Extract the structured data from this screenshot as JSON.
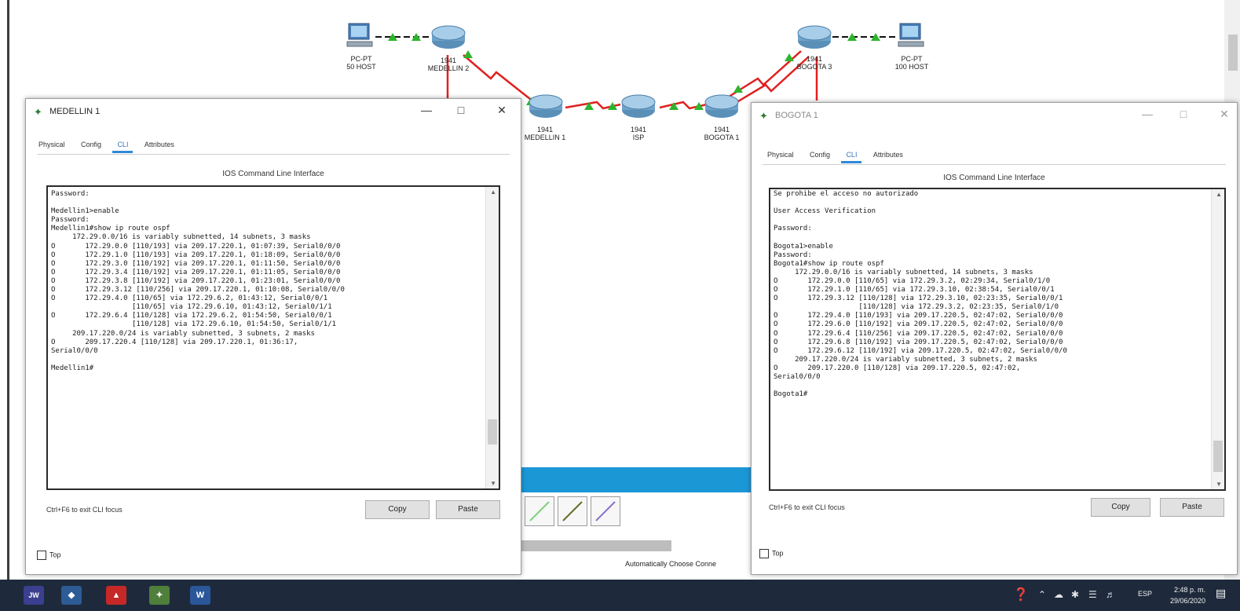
{
  "topology": {
    "devices": [
      {
        "id": "pc-medellin",
        "label_line1": "PC-PT",
        "label_line2": "50 HOST"
      },
      {
        "id": "router-medellin2",
        "label_line1": "1941",
        "label_line2": "MEDELLIN 2"
      },
      {
        "id": "router-medellin1",
        "label_line1": "1941",
        "label_line2": "MEDELLIN 1"
      },
      {
        "id": "router-isp",
        "label_line1": "1941",
        "label_line2": "ISP"
      },
      {
        "id": "router-bogota1",
        "label_line1": "1941",
        "label_line2": "BOGOTA 1"
      },
      {
        "id": "router-bogota3",
        "label_line1": "1941",
        "label_line2": "BOGOTA 3"
      },
      {
        "id": "pc-bogota",
        "label_line1": "PC-PT",
        "label_line2": "100 HOST"
      }
    ],
    "auto_cable_label": "Automatically Choose Conne"
  },
  "windows": {
    "medellin": {
      "title": "MEDELLIN 1",
      "tabs": [
        "Physical",
        "Config",
        "CLI",
        "Attributes"
      ],
      "active_tab": "CLI",
      "ios_title": "IOS Command Line Interface",
      "lines": [
        "Password:",
        "",
        "Medellin1>enable",
        "Password:",
        "Medellin1#show ip route ospf",
        "     172.29.0.0/16 is variably subnetted, 14 subnets, 3 masks",
        "O       172.29.0.0 [110/193] via 209.17.220.1, 01:07:39, Serial0/0/0",
        "O       172.29.1.0 [110/193] via 209.17.220.1, 01:18:09, Serial0/0/0",
        "O       172.29.3.0 [110/192] via 209.17.220.1, 01:11:50, Serial0/0/0",
        "O       172.29.3.4 [110/192] via 209.17.220.1, 01:11:05, Serial0/0/0",
        "O       172.29.3.8 [110/192] via 209.17.220.1, 01:23:01, Serial0/0/0",
        "O       172.29.3.12 [110/256] via 209.17.220.1, 01:10:08, Serial0/0/0",
        "O       172.29.4.0 [110/65] via 172.29.6.2, 01:43:12, Serial0/0/1",
        "                   [110/65] via 172.29.6.10, 01:43:12, Serial0/1/1",
        "O       172.29.6.4 [110/128] via 172.29.6.2, 01:54:50, Serial0/0/1",
        "                   [110/128] via 172.29.6.10, 01:54:50, Serial0/1/1",
        "     209.17.220.0/24 is variably subnetted, 3 subnets, 2 masks",
        "O       209.17.220.4 [110/128] via 209.17.220.1, 01:36:17,",
        "Serial0/0/0",
        "",
        "Medellin1#"
      ],
      "hint": "Ctrl+F6 to exit CLI focus",
      "copy_label": "Copy",
      "paste_label": "Paste",
      "top_label": "Top"
    },
    "bogota": {
      "title": "BOGOTA 1",
      "tabs": [
        "Physical",
        "Config",
        "CLI",
        "Attributes"
      ],
      "active_tab": "CLI",
      "ios_title": "IOS Command Line Interface",
      "lines": [
        "Se prohibe el acceso no autorizado",
        "",
        "User Access Verification",
        "",
        "Password:",
        "",
        "Bogota1>enable",
        "Password:",
        "Bogota1#show ip route ospf",
        "     172.29.0.0/16 is variably subnetted, 14 subnets, 3 masks",
        "O       172.29.0.0 [110/65] via 172.29.3.2, 02:29:34, Serial0/1/0",
        "O       172.29.1.0 [110/65] via 172.29.3.10, 02:38:54, Serial0/0/1",
        "O       172.29.3.12 [110/128] via 172.29.3.10, 02:23:35, Serial0/0/1",
        "                    [110/128] via 172.29.3.2, 02:23:35, Serial0/1/0",
        "O       172.29.4.0 [110/193] via 209.17.220.5, 02:47:02, Serial0/0/0",
        "O       172.29.6.0 [110/192] via 209.17.220.5, 02:47:02, Serial0/0/0",
        "O       172.29.6.4 [110/256] via 209.17.220.5, 02:47:02, Serial0/0/0",
        "O       172.29.6.8 [110/192] via 209.17.220.5, 02:47:02, Serial0/0/0",
        "O       172.29.6.12 [110/192] via 209.17.220.5, 02:47:02, Serial0/0/0",
        "     209.17.220.0/24 is variably subnetted, 3 subnets, 2 masks",
        "O       209.17.220.0 [110/128] via 209.17.220.5, 02:47:02,",
        "Serial0/0/0",
        "",
        "Bogota1#"
      ],
      "hint": "Ctrl+F6 to exit CLI focus",
      "copy_label": "Copy",
      "paste_label": "Paste",
      "top_label": "Top"
    }
  },
  "taskbar": {
    "clock_time": "2:48 p. m.",
    "clock_date": "29/06/2020",
    "lang": "ESP"
  }
}
